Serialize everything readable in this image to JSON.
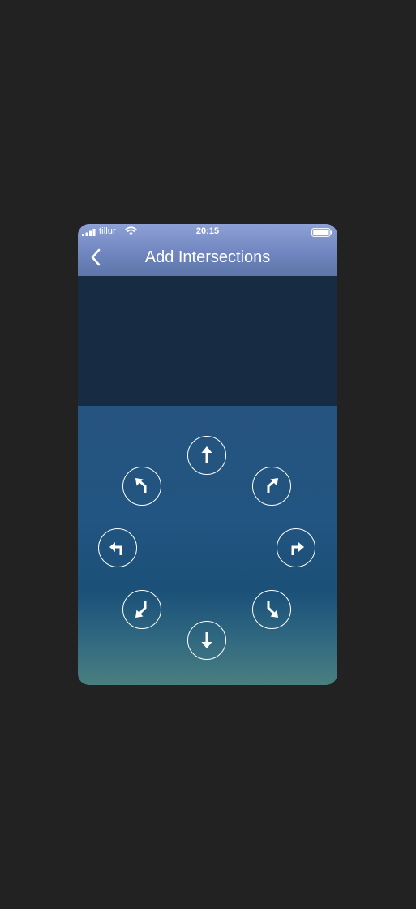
{
  "status_bar": {
    "carrier": "tillur",
    "time": "20:15"
  },
  "nav": {
    "title": "Add Intersections",
    "back_icon": "chevron-left-icon"
  },
  "directions": [
    {
      "name": "straight",
      "icon": "arrow-up-icon"
    },
    {
      "name": "slight-right",
      "icon": "arrow-slight-right-icon"
    },
    {
      "name": "right",
      "icon": "arrow-turn-right-icon"
    },
    {
      "name": "sharp-right",
      "icon": "arrow-sharp-right-icon"
    },
    {
      "name": "back",
      "icon": "arrow-down-icon"
    },
    {
      "name": "sharp-left",
      "icon": "arrow-sharp-left-icon"
    },
    {
      "name": "left",
      "icon": "arrow-turn-left-icon"
    },
    {
      "name": "slight-left",
      "icon": "arrow-slight-left-icon"
    }
  ],
  "colors": {
    "header_gradient_top": "#8ea1d6",
    "header_gradient_bottom": "#5d76a8",
    "map_area": "#172b43",
    "controls_top": "#26537f",
    "controls_bottom": "#4a7f80",
    "icon": "#ffffff"
  }
}
